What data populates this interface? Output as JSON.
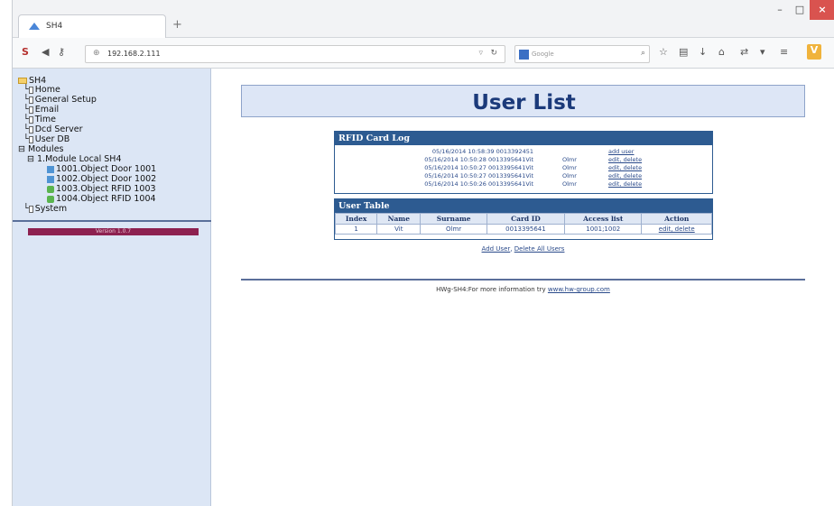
{
  "browser": {
    "tab_title": "SH4",
    "new_tab": "+",
    "url": "192.168.2.111",
    "search_placeholder": "Google",
    "win_min": "–",
    "win_max": "□",
    "win_close": "×"
  },
  "tree": {
    "root": "SH4",
    "items": [
      "Home",
      "General Setup",
      "Email",
      "Time",
      "Dcd Server",
      "User DB"
    ],
    "modules": "Modules",
    "module": "1.Module Local SH4",
    "objects": [
      "1001.Object Door 1001",
      "1002.Object Door 1002",
      "1003.Object RFID 1003",
      "1004.Object RFID 1004"
    ],
    "system": "System",
    "version": "Version 1.0.7"
  },
  "page": {
    "title": "User List"
  },
  "rfid_log": {
    "header": "RFID Card Log",
    "rows": [
      {
        "ts": "05/16/2014 10:58:39 0013392451",
        "name": "",
        "action": "add user"
      },
      {
        "ts": "05/16/2014 10:50:28 0013395641Vit",
        "name": "Olmr",
        "action": "edit, delete"
      },
      {
        "ts": "05/16/2014 10:50:27 0013395641Vit",
        "name": "Olmr",
        "action": "edit, delete"
      },
      {
        "ts": "05/16/2014 10:50:27 0013395641Vit",
        "name": "Olmr",
        "action": "edit, delete"
      },
      {
        "ts": "05/16/2014 10:50:26 0013395641Vit",
        "name": "Olmr",
        "action": "edit, delete"
      }
    ]
  },
  "user_table": {
    "header": "User Table",
    "columns": [
      "Index",
      "Name",
      "Surname",
      "Card ID",
      "Access list",
      "Action"
    ],
    "rows": [
      [
        "1",
        "Vit",
        "Olmr",
        "0013395641",
        "1001;1002",
        "edit, delete"
      ]
    ]
  },
  "links": {
    "add_user": "Add User",
    "sep": ", ",
    "delete_all": "Delete All Users"
  },
  "footer": {
    "text": "HWg-SH4:For more information try ",
    "link": "www.hw-group.com"
  }
}
